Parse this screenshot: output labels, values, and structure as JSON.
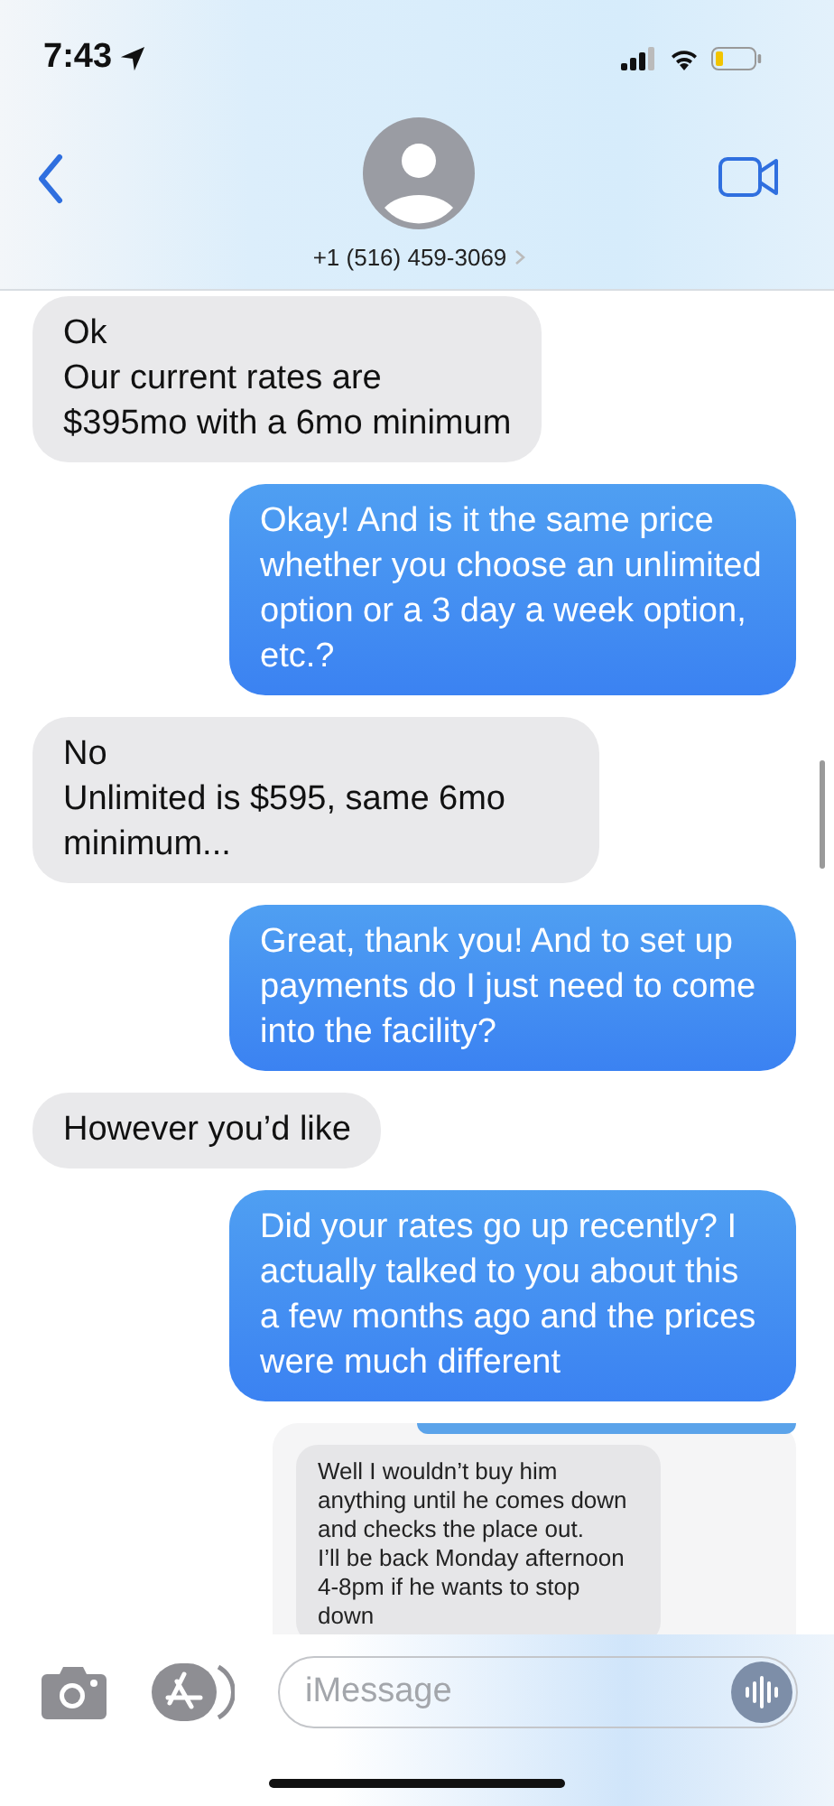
{
  "status_bar": {
    "time": "7:43"
  },
  "header": {
    "contact": "+1 (516) 459-3069"
  },
  "messages": [
    {
      "kind": "incoming",
      "text": "Ok\nOur current rates are\n$395mo with a 6mo minimum"
    },
    {
      "kind": "outgoing",
      "text": "Okay! And is it the same price whether you choose an unlimited option or a 3 day a week option, etc.?"
    },
    {
      "kind": "incoming",
      "text": "No\nUnlimited is $595, same 6mo minimum..."
    },
    {
      "kind": "outgoing",
      "text": "Great, thank you! And to set up payments do I just need to come into the facility?"
    },
    {
      "kind": "incoming",
      "text": "However you’d like"
    },
    {
      "kind": "outgoing",
      "text": "Did your rates go up recently? I actually talked to you about this a few months ago and the prices were much different"
    },
    {
      "kind": "screenshot",
      "text": "Well I wouldn’t buy him anything until he comes down and checks  the place out.\nI’ll be back Monday afternoon 4-8pm if he wants to stop down"
    }
  ],
  "compose": {
    "placeholder": "iMessage"
  }
}
